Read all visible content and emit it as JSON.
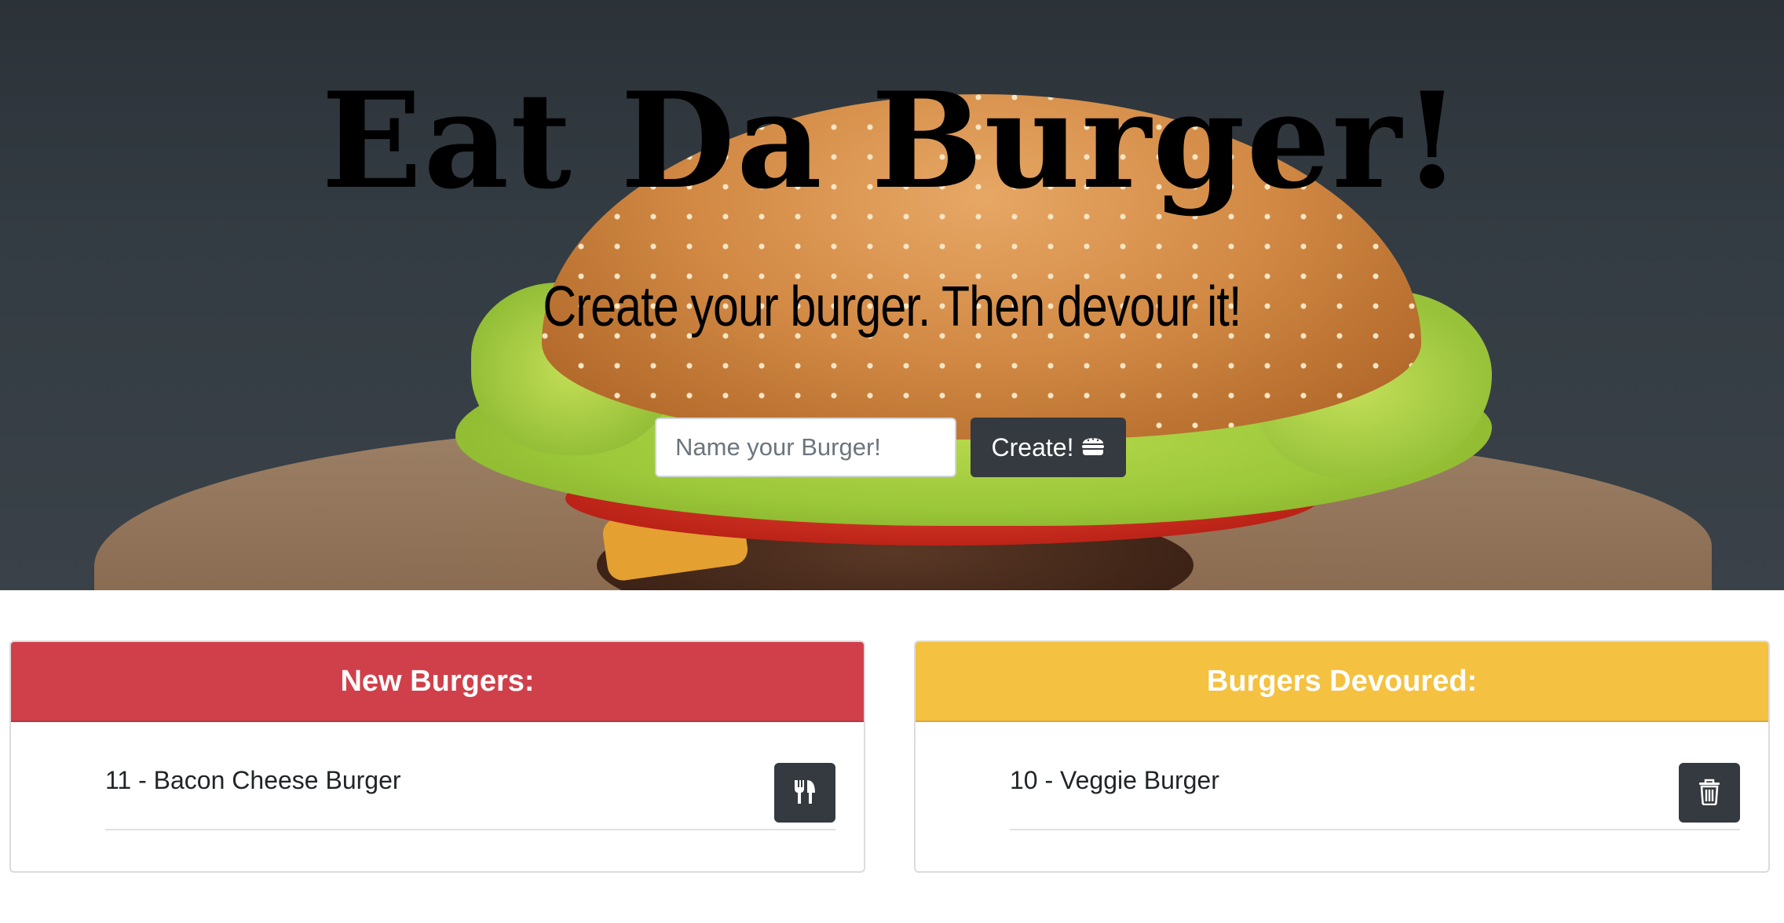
{
  "hero": {
    "title": "Eat Da Burger!",
    "subtitle": "Create your burger. Then devour it!",
    "form": {
      "input_placeholder": "Name your Burger!",
      "input_value": "",
      "create_label": "Create!",
      "create_icon": "hamburger-icon"
    }
  },
  "new_burgers": {
    "header": "New Burgers:",
    "header_color": "#d0404a",
    "items": [
      {
        "label": "11 - Bacon Cheese Burger",
        "action_icon": "utensils-icon"
      }
    ]
  },
  "devoured_burgers": {
    "header": "Burgers Devoured:",
    "header_color": "#f4c141",
    "items": [
      {
        "label": "10 - Veggie Burger",
        "action_icon": "trash-icon"
      }
    ]
  },
  "colors": {
    "button_dark": "#343a40",
    "text_dark": "#212529"
  }
}
